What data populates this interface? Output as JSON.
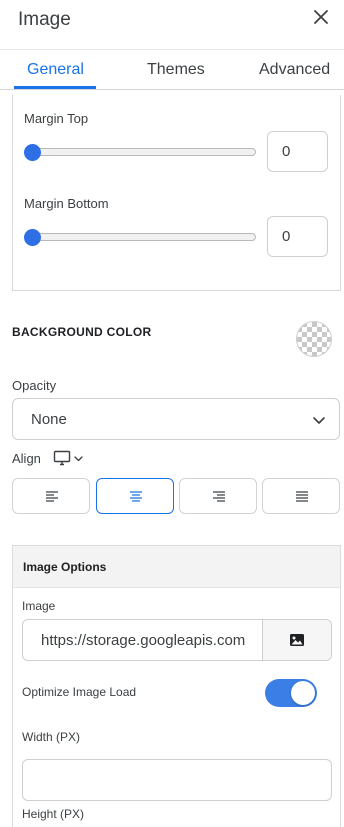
{
  "header": {
    "title": "Image",
    "close_icon": "close-icon"
  },
  "tabs": [
    {
      "label": "General",
      "active": true
    },
    {
      "label": "Themes",
      "active": false
    },
    {
      "label": "Advanced",
      "active": false
    }
  ],
  "margins": {
    "top": {
      "label": "Margin Top",
      "value": "0",
      "slider_fraction": 0
    },
    "bottom": {
      "label": "Margin Bottom",
      "value": "0",
      "slider_fraction": 0
    }
  },
  "background": {
    "label": "BACKGROUND COLOR",
    "swatch": "transparent"
  },
  "opacity": {
    "label": "Opacity",
    "selected": "None"
  },
  "align": {
    "label": "Align",
    "device_icon": "desktop-monitor-icon",
    "options": [
      "align-left-icon",
      "align-center-icon",
      "align-right-icon",
      "align-justify-icon"
    ],
    "active": "align-center-icon"
  },
  "image_options": {
    "title": "Image Options",
    "image_label": "Image",
    "image_url": "https://storage.googleapis.com",
    "browse_icon": "image-icon",
    "optimize_label": "Optimize Image Load",
    "optimize_on": true,
    "width_label": "Width (PX)",
    "width_value": "",
    "height_label": "Height (PX)"
  },
  "colors": {
    "accent": "#1a73e8",
    "toggle": "#3a7ee6",
    "slider_thumb": "#2f6fe6"
  }
}
